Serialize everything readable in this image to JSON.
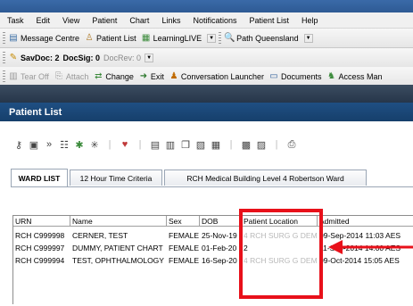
{
  "menubar": {
    "items": [
      "Task",
      "Edit",
      "View",
      "Patient",
      "Chart",
      "Links",
      "Notifications",
      "Patient List",
      "Help"
    ]
  },
  "toolbar1": {
    "message_centre": "Message Centre",
    "patient_list": "Patient List",
    "learninglive": "LearningLIVE",
    "path_queensland": "Path Queensland"
  },
  "toolbar2": {
    "savdoc": "SavDoc: 2",
    "docsig": "DocSig: 0",
    "docrev": "DocRev: 0"
  },
  "toolbar3": {
    "tear_off": "Tear Off",
    "attach": "Attach",
    "change": "Change",
    "exit": "Exit",
    "conversation_launcher": "Conversation Launcher",
    "documents": "Documents",
    "access_man": "Access Man"
  },
  "patient_list_header": "Patient List",
  "tabs": [
    "WARD LIST",
    "12 Hour Time Criteria",
    "RCH Medical Building Level 4 Robertson Ward"
  ],
  "table": {
    "headers": [
      "URN",
      "Name",
      "Sex",
      "DOB",
      "Patient Location",
      "Admitted"
    ],
    "rows": [
      [
        "RCH C999998",
        "CERNER, TEST",
        "FEMALE",
        "25-Nov-19",
        "4 RCH SURG G DEM",
        "09-Sep-2014 11:03 AES"
      ],
      [
        "RCH C999997",
        "DUMMY, PATIENT CHART",
        "FEMALE",
        "01-Feb-20",
        "2",
        "11-Sep-2014 14:00 AES"
      ],
      [
        "RCH C999994",
        "TEST, OPHTHALMOLOGY",
        "FEMALE",
        "16-Sep-20",
        "4 RCH SURG G DEM",
        "09-Oct-2014 15:05 AES"
      ]
    ]
  },
  "colors": {
    "highlight_box": "#e8101a",
    "arrow": "#e8101a",
    "header_blue": "#1f4f83"
  }
}
